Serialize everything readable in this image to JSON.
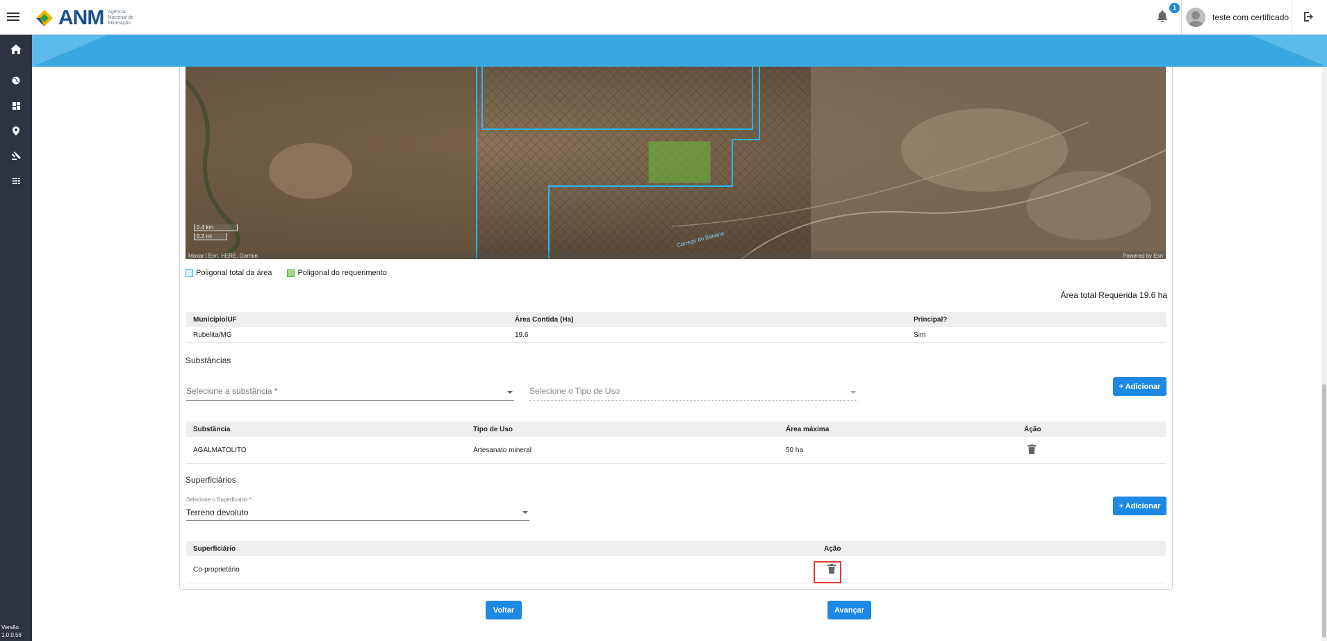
{
  "header": {
    "logo_text": "ANM",
    "logo_subtitle": "Agência Nacional de Mineração",
    "notification_count": "1",
    "user_name": "teste com certificado"
  },
  "sidebar": {
    "items": [
      {
        "icon": "home-icon"
      },
      {
        "icon": "globe-icon"
      },
      {
        "icon": "dashboard-icon"
      },
      {
        "icon": "location-pin-icon"
      },
      {
        "icon": "gavel-icon"
      },
      {
        "icon": "grid-icon"
      }
    ],
    "version_label": "Versão",
    "version_number": "1.0.0.56"
  },
  "map": {
    "scale_km": "0.4 km",
    "scale_mi": "0.2 mi",
    "credit_left": "Maxar | Esri, HERE, Garmin",
    "credit_right": "Powered by Esri",
    "road_label": "Córrego do Banana"
  },
  "legend": {
    "total_area": "Poligonal total da área",
    "request_area": "Poligonal do requerimento"
  },
  "area_total": "Área total Requerida 19.6 ha",
  "municipio_table": {
    "headers": [
      "Município/UF",
      "Área Contida (Ha)",
      "Principal?"
    ],
    "rows": [
      [
        "Rubelita/MG",
        "19.6",
        "Sim"
      ]
    ]
  },
  "substancias": {
    "title": "Substâncias",
    "substance_placeholder": "Selecione a substância *",
    "use_type_placeholder": "Selecione o Tipo de Uso",
    "add_button": "+ Adicionar",
    "headers": [
      "Substância",
      "Tipo de Uso",
      "Área máxima",
      "Ação"
    ],
    "rows": [
      [
        "AGALMATOLITO",
        "Artesanato mineral",
        "50 ha"
      ]
    ]
  },
  "superficiarios": {
    "title": "Superficiários",
    "select_label": "Selecione o Superficiário *",
    "select_value": "Terreno devoluto",
    "add_button": "+ Adicionar",
    "headers": [
      "Superficiário",
      "Ação"
    ],
    "rows": [
      [
        "Co-proprietário"
      ]
    ]
  },
  "footer": {
    "back_button": "Voltar",
    "next_button": "Avançar"
  },
  "colors": {
    "primary": "#1e88e5",
    "sidebar": "#2e3340",
    "banner": "#3aa8e0",
    "highlight": "#e53935",
    "polygon_outline": "#29b6f6",
    "request_polygon": "#6abf3a"
  }
}
